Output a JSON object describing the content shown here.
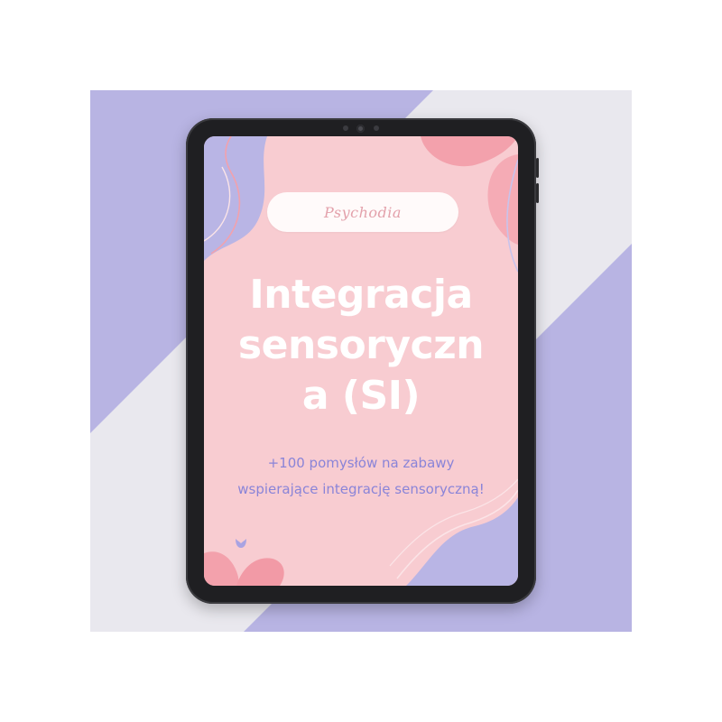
{
  "brand": {
    "name": "Psychodia"
  },
  "cover": {
    "title_lines": [
      "Integracja",
      "sensoryczn",
      "a (SI)"
    ],
    "subtitle_lines": [
      "+100 pomysłów na zabawy",
      "wspierające integrację sensoryczną!"
    ]
  },
  "colors": {
    "backdrop_light": "#e9e8ee",
    "backdrop_lavender": "#b8b4e3",
    "screen_pink": "#f8ccd1",
    "shape_lavender": "#b9b5e5",
    "shape_coral": "#f3a1ac",
    "title_white": "#ffffff",
    "subtitle_purple": "#8a84d8",
    "tablet_frame": "#1f1f22"
  },
  "icons": {
    "flower": "flower-bud-icon",
    "camera": "camera-icon"
  }
}
